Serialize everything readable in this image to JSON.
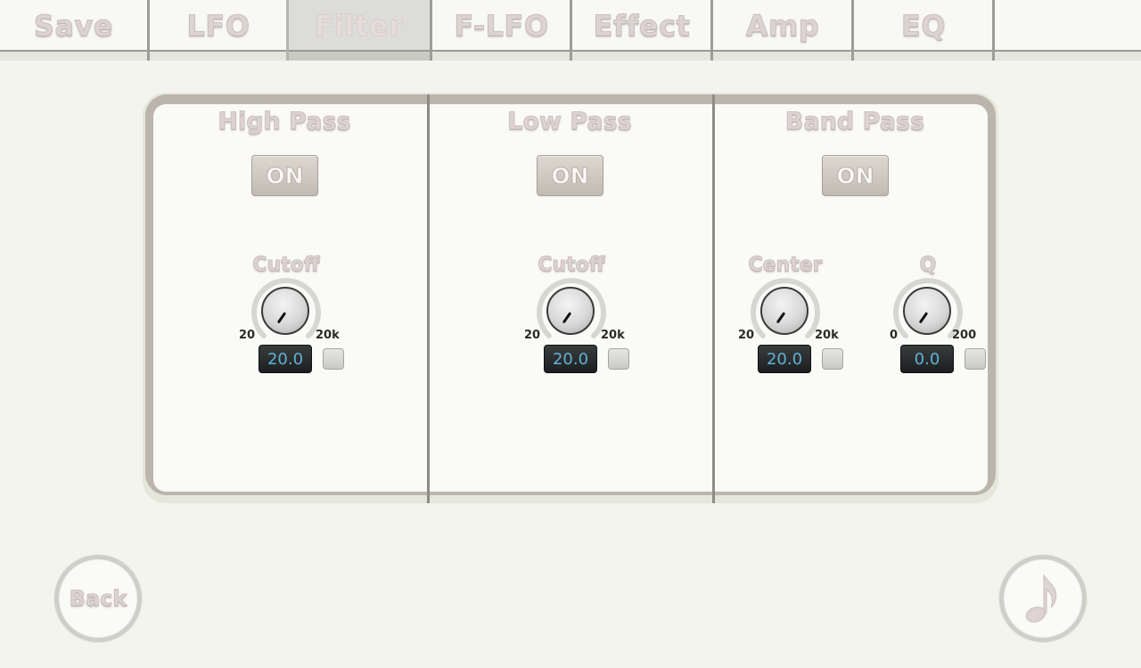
{
  "tabs": [
    {
      "label": "Save",
      "active": false
    },
    {
      "label": "LFO",
      "active": false
    },
    {
      "label": "Filter",
      "active": true
    },
    {
      "label": "F-LFO",
      "active": false
    },
    {
      "label": "Effect",
      "active": false
    },
    {
      "label": "Amp",
      "active": false
    },
    {
      "label": "EQ",
      "active": false
    }
  ],
  "filter": {
    "high_pass": {
      "title": "High Pass",
      "toggle_label": "ON",
      "cutoff": {
        "label": "Cutoff",
        "min": "20",
        "max": "20k",
        "value": "20.0"
      }
    },
    "low_pass": {
      "title": "Low Pass",
      "toggle_label": "ON",
      "cutoff": {
        "label": "Cutoff",
        "min": "20",
        "max": "20k",
        "value": "20.0"
      }
    },
    "band_pass": {
      "title": "Band Pass",
      "toggle_label": "ON",
      "center": {
        "label": "Center",
        "min": "20",
        "max": "20k",
        "value": "20.0"
      },
      "q": {
        "label": "Q",
        "min": "0",
        "max": "200",
        "value": "0.0"
      }
    }
  },
  "footer": {
    "back_label": "Back",
    "music_icon": "music-note-icon"
  },
  "colors": {
    "label_text": "#ddd3d1",
    "value_text": "#5fb2d6",
    "active_tab": "#dcddd8"
  }
}
